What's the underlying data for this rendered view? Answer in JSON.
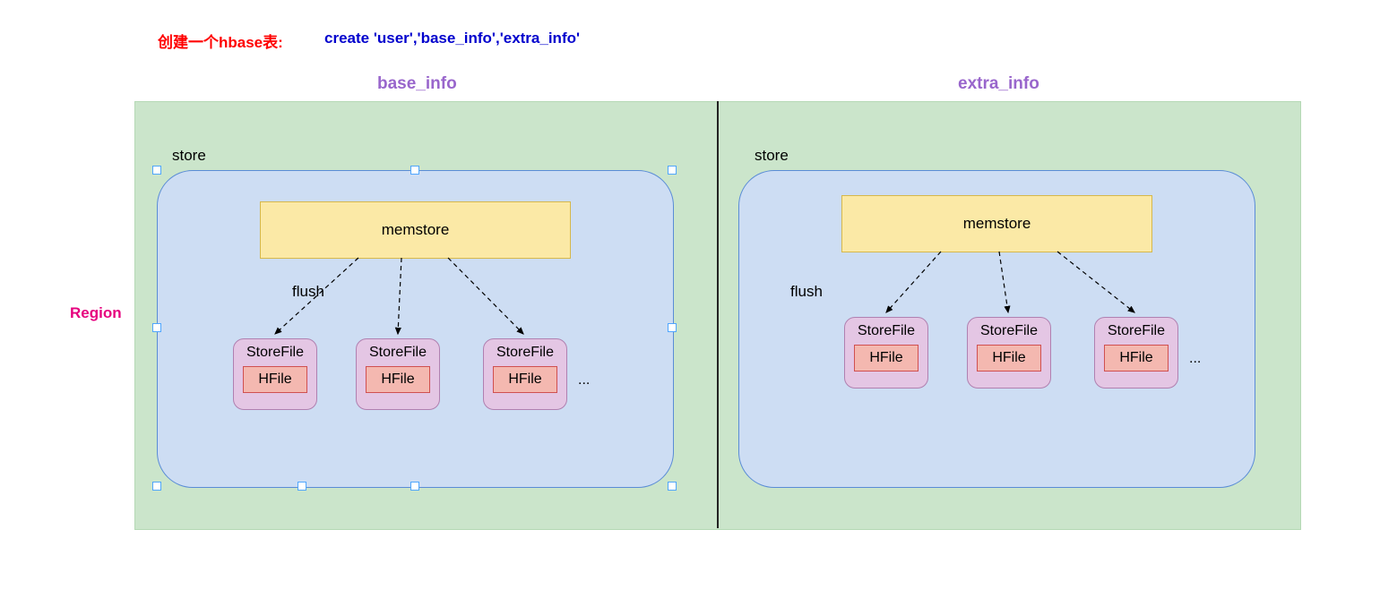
{
  "title_prefix": "创建一个hbase表:",
  "title_command": "create  'user','base_info','extra_info'",
  "region_label": "Region",
  "columns": [
    {
      "name": "base_info"
    },
    {
      "name": "extra_info"
    }
  ],
  "store_label": "store",
  "memstore_label": "memstore",
  "flush_label": "flush",
  "storefile_label": "StoreFile",
  "hfile_label": "HFile",
  "ellipsis": "...",
  "storefiles_per_column": 3,
  "arrow_style": "dashed",
  "colors": {
    "region_bg": "#cbe5cb",
    "store_bg": "#cdddf3",
    "memstore_bg": "#fbe9a6",
    "storefile_bg": "#e4c6e4",
    "hfile_bg": "#f4b8b0",
    "col_head": "#9966cc",
    "region_text": "#e6007e",
    "title_red": "#ff0000",
    "title_blue": "#0000cd"
  }
}
